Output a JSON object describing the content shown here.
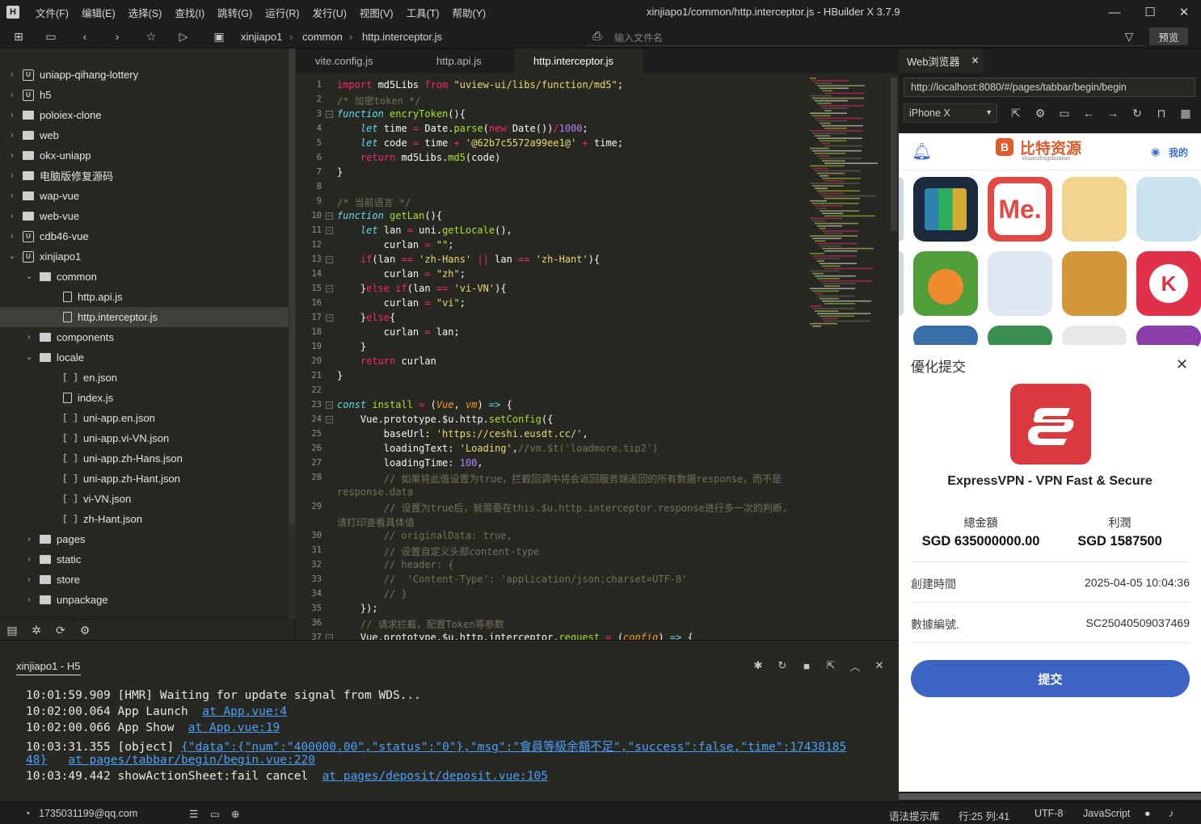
{
  "window": {
    "title": "xinjiapo1/common/http.interceptor.js - HBuilder X 3.7.9",
    "logo": "H"
  },
  "menu": [
    "文件(F)",
    "编辑(E)",
    "选择(S)",
    "查找(I)",
    "跳转(G)",
    "运行(R)",
    "发行(U)",
    "视图(V)",
    "工具(T)",
    "帮助(Y)"
  ],
  "toolbar": {
    "breadcrumbs": [
      "xinjiapo1",
      "common",
      "http.interceptor.js"
    ],
    "file_search_placeholder": "输入文件名",
    "preview_label": "预览"
  },
  "sidebar": {
    "items": [
      {
        "label": "uniapp-qihang-lottery",
        "type": "proj",
        "depth": 0,
        "arrow": "›"
      },
      {
        "label": "h5",
        "type": "proj",
        "depth": 0,
        "arrow": "›"
      },
      {
        "label": "poloiex-clone",
        "type": "folder",
        "depth": 0,
        "arrow": "›"
      },
      {
        "label": "web",
        "type": "folder",
        "depth": 0,
        "arrow": "›"
      },
      {
        "label": "okx-uniapp",
        "type": "folder",
        "depth": 0,
        "arrow": "›"
      },
      {
        "label": "电脑版修复源码",
        "type": "folder",
        "depth": 0,
        "arrow": "›"
      },
      {
        "label": "wap-vue",
        "type": "folder",
        "depth": 0,
        "arrow": "›"
      },
      {
        "label": "web-vue",
        "type": "folder",
        "depth": 0,
        "arrow": "›"
      },
      {
        "label": "cdb46-vue",
        "type": "proj",
        "depth": 0,
        "arrow": "›"
      },
      {
        "label": "xinjiapo1",
        "type": "proj",
        "depth": 0,
        "arrow": "⌄"
      },
      {
        "label": "common",
        "type": "folder",
        "depth": 1,
        "arrow": "⌄"
      },
      {
        "label": "http.api.js",
        "type": "file",
        "depth": 2,
        "arrow": ""
      },
      {
        "label": "http.interceptor.js",
        "type": "file",
        "depth": 2,
        "arrow": "",
        "selected": true
      },
      {
        "label": "components",
        "type": "folder",
        "depth": 1,
        "arrow": "›"
      },
      {
        "label": "locale",
        "type": "folder",
        "depth": 1,
        "arrow": "⌄"
      },
      {
        "label": "en.json",
        "type": "json",
        "depth": 2,
        "arrow": ""
      },
      {
        "label": "index.js",
        "type": "file",
        "depth": 2,
        "arrow": ""
      },
      {
        "label": "uni-app.en.json",
        "type": "json",
        "depth": 2,
        "arrow": ""
      },
      {
        "label": "uni-app.vi-VN.json",
        "type": "json",
        "depth": 2,
        "arrow": ""
      },
      {
        "label": "uni-app.zh-Hans.json",
        "type": "json",
        "depth": 2,
        "arrow": ""
      },
      {
        "label": "uni-app.zh-Hant.json",
        "type": "json",
        "depth": 2,
        "arrow": ""
      },
      {
        "label": "vi-VN.json",
        "type": "json",
        "depth": 2,
        "arrow": ""
      },
      {
        "label": "zh-Hant.json",
        "type": "json",
        "depth": 2,
        "arrow": ""
      },
      {
        "label": "pages",
        "type": "folder",
        "depth": 1,
        "arrow": "›"
      },
      {
        "label": "static",
        "type": "folder",
        "depth": 1,
        "arrow": "›"
      },
      {
        "label": "store",
        "type": "folder",
        "depth": 1,
        "arrow": "›"
      },
      {
        "label": "unpackage",
        "type": "folder",
        "depth": 1,
        "arrow": "›"
      }
    ]
  },
  "tabs": [
    {
      "label": "vite.config.js"
    },
    {
      "label": "http.api.js"
    },
    {
      "label": "http.interceptor.js",
      "active": true
    }
  ],
  "code": [
    {
      "n": "1",
      "fold": false,
      "html": "<span class='k'>import</span> md5Libs <span class='k'>from</span> <span class='s'>\"uview-ui/libs/function/md5\"</span>;"
    },
    {
      "n": "2",
      "fold": false,
      "html": "<span class='c'>/* 加密token */</span>"
    },
    {
      "n": "3",
      "fold": true,
      "html": "<span class='it'>function</span> <span class='f'>encryToken</span>(){"
    },
    {
      "n": "4",
      "fold": false,
      "html": "    <span class='it'>let</span> time <span class='k'>=</span> Date.<span class='f'>parse</span>(<span class='k'>new</span> Date())<span class='k'>/</span><span class='n'>1000</span>;"
    },
    {
      "n": "5",
      "fold": false,
      "html": "    <span class='it'>let</span> code <span class='k'>=</span> time <span class='k'>+</span> <span class='s'>'@62b7c5572a99ee1@'</span> <span class='k'>+</span> time;"
    },
    {
      "n": "6",
      "fold": false,
      "html": "    <span class='k'>return</span> md5Libs.<span class='f'>md5</span>(code)"
    },
    {
      "n": "7",
      "fold": false,
      "html": "}"
    },
    {
      "n": "8",
      "fold": false,
      "html": ""
    },
    {
      "n": "9",
      "fold": false,
      "html": "<span class='c'>/* 当前语言 */</span>"
    },
    {
      "n": "10",
      "fold": true,
      "html": "<span class='it'>function</span> <span class='f'>getLan</span>(){"
    },
    {
      "n": "11",
      "fold": true,
      "html": "    <span class='it'>let</span> lan <span class='k'>=</span> uni.<span class='f'>getLocale</span>(),"
    },
    {
      "n": "12",
      "fold": false,
      "html": "        curlan <span class='k'>=</span> <span class='s'>\"\"</span>;"
    },
    {
      "n": "13",
      "fold": true,
      "html": "    <span class='k'>if</span>(lan <span class='k'>==</span> <span class='s'>'zh-Hans'</span> <span class='k'>||</span> lan <span class='k'>==</span> <span class='s'>'zh-Hant'</span>){"
    },
    {
      "n": "14",
      "fold": false,
      "html": "        curlan <span class='k'>=</span> <span class='s'>\"zh\"</span>;"
    },
    {
      "n": "15",
      "fold": true,
      "html": "    }<span class='k'>else</span> <span class='k'>if</span>(lan <span class='k'>==</span> <span class='s'>'vi-VN'</span>){"
    },
    {
      "n": "16",
      "fold": false,
      "html": "        curlan <span class='k'>=</span> <span class='s'>\"vi\"</span>;"
    },
    {
      "n": "17",
      "fold": true,
      "html": "    }<span class='k'>else</span>{"
    },
    {
      "n": "18",
      "fold": false,
      "html": "        curlan <span class='k'>=</span> lan;"
    },
    {
      "n": "19",
      "fold": false,
      "html": "    }"
    },
    {
      "n": "20",
      "fold": false,
      "html": "    <span class='k'>return</span> curlan"
    },
    {
      "n": "21",
      "fold": false,
      "html": "}"
    },
    {
      "n": "22",
      "fold": false,
      "html": ""
    },
    {
      "n": "23",
      "fold": true,
      "html": "<span class='it'>const</span> <span class='f'>install</span> <span class='k'>=</span> (<span class='p'>Vue</span>, <span class='p'>vm</span>) <span class='it'>=&gt;</span> {"
    },
    {
      "n": "24",
      "fold": true,
      "html": "    Vue.prototype.$u.http.<span class='f'>setConfig</span>({"
    },
    {
      "n": "25",
      "fold": false,
      "html": "        baseUrl: <span class='s'>'https://ceshi.eusdt.cc/'</span>,"
    },
    {
      "n": "26",
      "fold": false,
      "html": "        loadingText: <span class='s'>'Loading'</span>,<span class='c'>//vm.$t('loadmore.tip2')</span>"
    },
    {
      "n": "27",
      "fold": false,
      "html": "        loadingTime: <span class='n'>100</span>,"
    },
    {
      "n": "28",
      "fold": false,
      "html": "        <span class='c'>// 如果将此值设置为true，拦截回调中将会返回服务端返回的所有数据response，而不是</span>"
    },
    {
      "n": "",
      "fold": false,
      "html": "<span class='c'>response.data</span>"
    },
    {
      "n": "29",
      "fold": false,
      "html": "        <span class='c'>// 设置为true后，就需要在this.$u.http.interceptor.response进行多一次的判断，</span>"
    },
    {
      "n": "",
      "fold": false,
      "html": "<span class='c'>请打印查看具体值</span>"
    },
    {
      "n": "30",
      "fold": false,
      "html": "        <span class='c'>// originalData: true,</span>"
    },
    {
      "n": "31",
      "fold": false,
      "html": "        <span class='c'>// 设置自定义头部content-type</span>"
    },
    {
      "n": "32",
      "fold": false,
      "html": "        <span class='c'>// header: {</span>"
    },
    {
      "n": "33",
      "fold": false,
      "html": "        <span class='c'>//  'Content-Type': 'application/json;charset=UTF-8'</span>"
    },
    {
      "n": "34",
      "fold": false,
      "html": "        <span class='c'>// }</span>"
    },
    {
      "n": "35",
      "fold": false,
      "html": "    });"
    },
    {
      "n": "36",
      "fold": false,
      "html": "    <span class='c'>// 请求拦截，配置Token等参数</span>"
    },
    {
      "n": "37",
      "fold": true,
      "html": "    Vue.prototype.$u.http.interceptor.<span class='f'>request</span> <span class='k'>=</span> (<span class='p'>config</span>) <span class='it'>=&gt;</span> {"
    }
  ],
  "webview": {
    "tab_label": "Web浏览器",
    "url": "http://localhost:8080/#/pages/tabbar/begin/begin",
    "device": "iPhone X",
    "app_header": {
      "brand": "比特资源",
      "brand_sub": "shuanzhogsbuaiian",
      "my_label": "我的"
    },
    "sheet": {
      "title": "優化提交",
      "app_name": "ExpressVPN - VPN Fast & Secure",
      "total_label": "總金額",
      "total_value": "SGD 635000000.00",
      "profit_label": "利潤",
      "profit_value": "SGD 1587500",
      "created_label": "創建時間",
      "created_value": "2025-04-05 10:04:36",
      "id_label": "數據編號.",
      "id_value": "SC25040509037469",
      "submit_label": "提交"
    }
  },
  "console": {
    "tab_label": "xinjiapo1 - H5",
    "lines": [
      {
        "text": "10:01:59.909 [HMR] Waiting for update signal from WDS...",
        "link": ""
      },
      {
        "text": "10:02:00.064 App Launch  ",
        "link": "at App.vue:4"
      },
      {
        "text": "10:02:00.066 App Show  ",
        "link": "at App.vue:19"
      },
      {
        "text": "10:03:31.355 [object] ",
        "link": "{\"data\":{\"num\":\"400000.00\",\"status\":\"0\"},\"msg\":\"會員等級余額不足\",\"success\":false,\"time\":17438185"
      },
      {
        "text": "",
        "link": "48}",
        "link2": "at pages/tabbar/begin/begin.vue:220"
      },
      {
        "text": "10:03:49.442 showActionSheet:fail cancel  ",
        "link": "at pages/deposit/deposit.vue:105"
      }
    ]
  },
  "status": {
    "user": "1735031199@qq.com",
    "hint_lib": "语法提示库",
    "position": "行:25  列:41",
    "encoding": "UTF-8",
    "language": "JavaScript"
  }
}
